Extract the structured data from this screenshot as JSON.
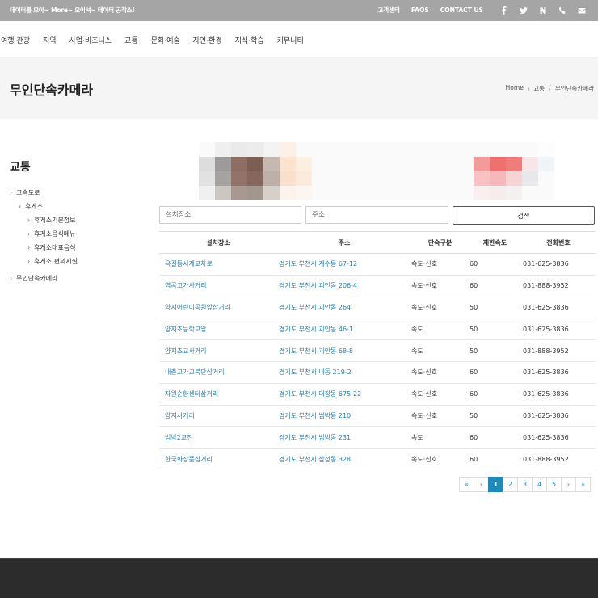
{
  "topbar": {
    "slogan": "데이터를 모아~ More~ 모이셔~ 데이터 공작소!",
    "links": [
      "고객센터",
      "FAQS",
      "CONTACT US"
    ],
    "icons": [
      "facebook-icon",
      "twitter-icon",
      "naver-icon",
      "phone-icon",
      "mail-icon"
    ]
  },
  "nav": {
    "items": [
      "여행·관광",
      "지역",
      "사업·비즈니스",
      "교통",
      "문화·예술",
      "자연·환경",
      "지식·학습",
      "커뮤니티"
    ]
  },
  "page": {
    "title": "무인단속카메라",
    "breadcrumb": [
      "Home",
      "교통",
      "무인단속카메라"
    ]
  },
  "sidebar": {
    "title": "교통",
    "items": [
      {
        "label": "고속도로",
        "level": 0
      },
      {
        "label": "휴게소",
        "level": 1
      },
      {
        "label": "휴게소기본정보",
        "level": 2
      },
      {
        "label": "휴게소음식메뉴",
        "level": 2
      },
      {
        "label": "휴게소대표음식",
        "level": 2
      },
      {
        "label": "휴게소 편의시설",
        "level": 2
      },
      {
        "label": "무인단속카메라",
        "level": 0
      }
    ]
  },
  "search": {
    "location_placeholder": "설치장소",
    "address_placeholder": "주소",
    "button_label": "검색"
  },
  "table": {
    "headers": [
      "설치장소",
      "주소",
      "단속구분",
      "제한속도",
      "전화번호"
    ],
    "rows": [
      [
        "옥길동시계교차로",
        "경기도 부천시 계수동 67-12",
        "속도·신호",
        "60",
        "031-625-3836"
      ],
      [
        "역곡고가사거리",
        "경기도 부천시 괴안동 206-4",
        "속도·신호",
        "60",
        "031-888-3952"
      ],
      [
        "양지어린이공원앞삼거리",
        "경기도 부천시 괴안동 264",
        "속도·신호",
        "50",
        "031-625-3836"
      ],
      [
        "양지초등학교앞",
        "경기도 부천시 괴안동 46-1",
        "속도",
        "50",
        "031-625-3836"
      ],
      [
        "양지초교사거리",
        "경기도 부천시 괴안동 68-8",
        "속도",
        "50",
        "031-888-3952"
      ],
      [
        "내촌고가교북단삼거리",
        "경기도 부천시 내동 219-2",
        "속도·신호",
        "60",
        "031-625-3836"
      ],
      [
        "자원순환센터삼거리",
        "경기도 부천시 대장동 675-22",
        "속도·신호",
        "60",
        "031-625-3836"
      ],
      [
        "양지사거리",
        "경기도 부천시 범박동 210",
        "속도·신호",
        "50",
        "031-625-3836"
      ],
      [
        "범박2교전",
        "경기도 부천시 범박동 231",
        "속도",
        "60",
        "031-625-3836"
      ],
      [
        "한국화장품삼거리",
        "경기도 부천시 삼정동 328",
        "속도·신호",
        "60",
        "031-888-3952"
      ]
    ]
  },
  "pagination": {
    "items": [
      "«",
      "‹",
      "1",
      "2",
      "3",
      "4",
      "5",
      "›",
      "»"
    ],
    "active": "1"
  },
  "colors": {
    "link": "#2a7fb1",
    "active_page": "#1f8ab9",
    "topbar": "#a5a5a5",
    "footer": "#2c2c2c"
  }
}
